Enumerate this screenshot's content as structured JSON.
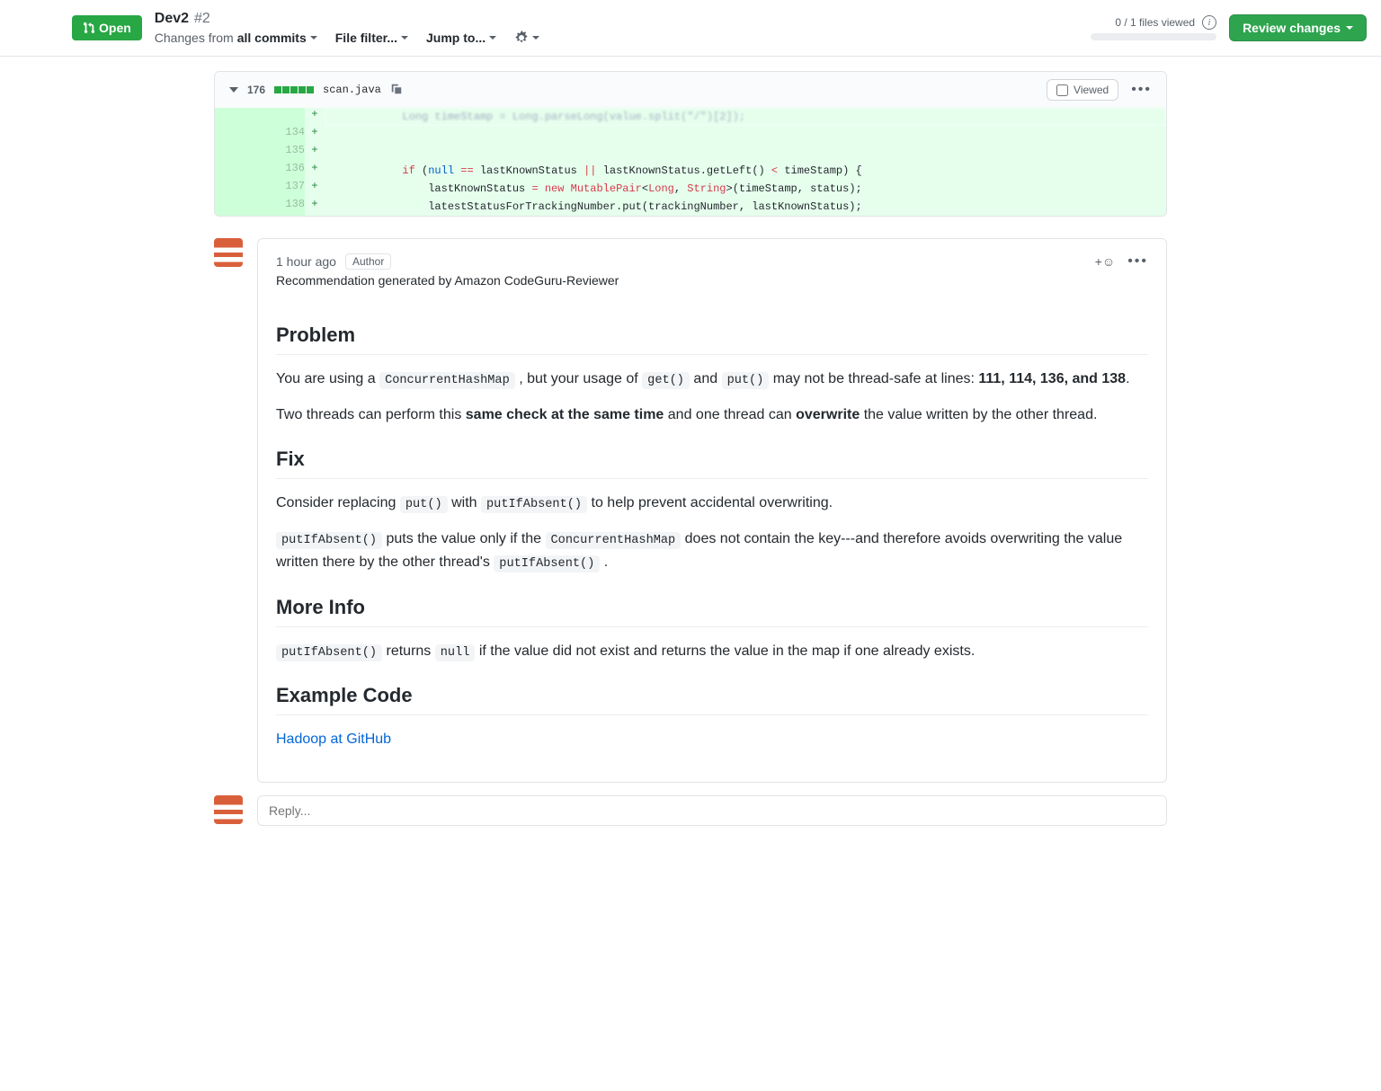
{
  "header": {
    "state_label": "Open",
    "title": "Dev2",
    "pr_number": "#2",
    "changes_from_prefix": "Changes from ",
    "changes_from_bold": "all commits",
    "file_filter": "File filter...",
    "jump_to": "Jump to...",
    "files_viewed": "0 / 1 files viewed",
    "review_changes": "Review changes"
  },
  "file": {
    "diff_count": "176",
    "name": "scan.java",
    "viewed_label": "Viewed"
  },
  "diff_rows": [
    {
      "ln": "134",
      "m": "+",
      "html": " "
    },
    {
      "ln": "135",
      "m": "+",
      "html": " "
    },
    {
      "ln": "136",
      "m": "+",
      "html": "            <span class=\"tk-k\">if</span> (<span class=\"tk-g\">null</span> <span class=\"tk-o\">==</span> lastKnownStatus <span class=\"tk-o\">||</span> lastKnownStatus.getLeft() <span class=\"tk-o\">&lt;</span> timeStamp) {"
    },
    {
      "ln": "137",
      "m": "+",
      "html": "                lastKnownStatus <span class=\"tk-o\">=</span> <span class=\"tk-k\">new</span> <span class=\"tk-t\">MutablePair</span>&lt;<span class=\"tk-t\">Long</span>, <span class=\"tk-t\">String</span>&gt;(timeStamp, status);"
    },
    {
      "ln": "138",
      "m": "+",
      "html": "                latestStatusForTrackingNumber.put(trackingNumber, lastKnownStatus);"
    }
  ],
  "comment": {
    "timestamp": "1 hour ago",
    "author_badge": "Author",
    "subtitle": "Recommendation generated by Amazon CodeGuru-Reviewer",
    "h_problem": "Problem",
    "p1_a": "You are using a ",
    "p1_code1": "ConcurrentHashMap",
    "p1_b": " , but your usage of ",
    "p1_code2": "get()",
    "p1_c": " and ",
    "p1_code3": "put()",
    "p1_d": " may not be thread-safe at lines: ",
    "p1_bold": "111, 114, 136, and 138",
    "p1_e": ".",
    "p2_a": "Two threads can perform this ",
    "p2_b1": "same check at the same time",
    "p2_b": " and one thread can ",
    "p2_b2": "overwrite",
    "p2_c": " the value written by the other thread.",
    "h_fix": "Fix",
    "p3_a": "Consider replacing ",
    "p3_code1": "put()",
    "p3_b": " with ",
    "p3_code2": "putIfAbsent()",
    "p3_c": " to help prevent accidental overwriting.",
    "p4_code1": "putIfAbsent()",
    "p4_a": " puts the value only if the ",
    "p4_code2": "ConcurrentHashMap",
    "p4_b": " does not contain the key---and therefore avoids overwriting the value written there by the other thread's ",
    "p4_code3": "putIfAbsent()",
    "p4_c": " .",
    "h_more": "More Info",
    "p5_code1": "putIfAbsent()",
    "p5_a": " returns ",
    "p5_code2": "null",
    "p5_b": " if the value did not exist and returns the value in the map if one already exists.",
    "h_example": "Example Code",
    "link": "Hadoop at GitHub"
  },
  "reply": {
    "placeholder": "Reply..."
  }
}
